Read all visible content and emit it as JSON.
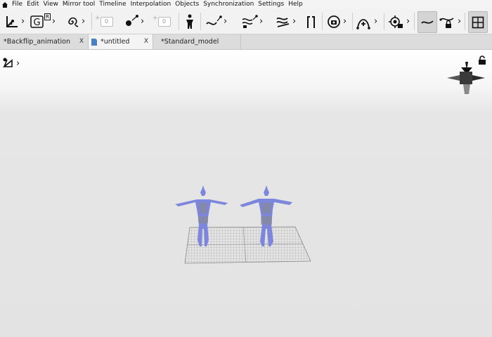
{
  "menubar": {
    "home_icon": "home-icon",
    "items": [
      "File",
      "Edit",
      "View",
      "Mirror tool",
      "Timeline",
      "Interpolation",
      "Objects",
      "Synchronization",
      "Settings",
      "Help"
    ]
  },
  "toolbar": {
    "keyframe_add_value": "0",
    "keyframe_remove_value": "0",
    "g_badge": "R"
  },
  "tabs": [
    {
      "label": "*Backflip_animation",
      "close": "X",
      "active": false
    },
    {
      "label": "*untitled",
      "close": "X",
      "active": true
    },
    {
      "label": "*Standard_model",
      "close": "",
      "active": false
    }
  ],
  "colors": {
    "accent_blue": "#4a7fc0",
    "figure_blue": "#7c86dc",
    "figure_gray": "#8a8a8a",
    "grid": "#9a9a9a"
  }
}
